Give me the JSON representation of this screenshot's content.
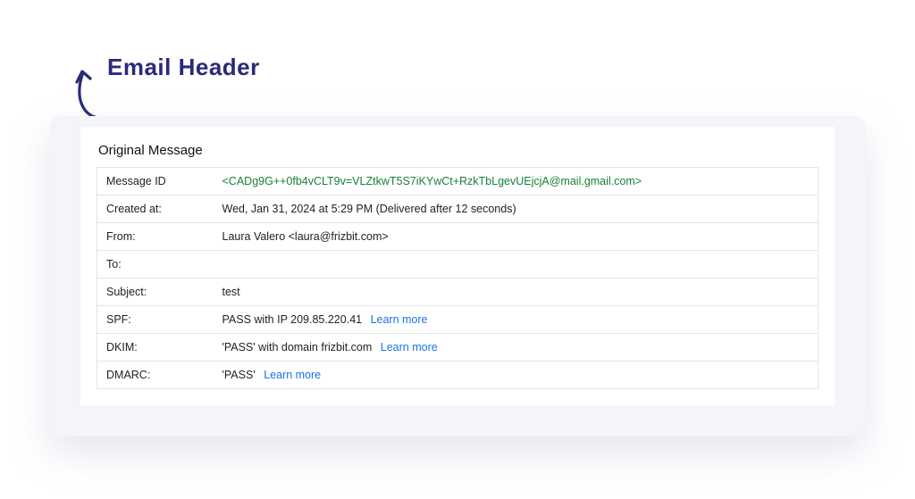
{
  "annotation": {
    "title": "Email Header"
  },
  "panel": {
    "title": "Original Message"
  },
  "rows": {
    "message_id": {
      "label": "Message ID",
      "value": "<CADg9G++0fb4vCLT9v=VLZtkwT5S7iKYwCt+RzkTbLgevUEjcjA@mail.gmail.com>"
    },
    "created_at": {
      "label": "Created at:",
      "value": "Wed, Jan 31, 2024 at 5:29 PM (Delivered after 12 seconds)"
    },
    "from": {
      "label": "From:",
      "value": "Laura Valero <laura@frizbit.com>"
    },
    "to": {
      "label": "To:",
      "value": ""
    },
    "subject": {
      "label": "Subject:",
      "value": "test"
    },
    "spf": {
      "label": "SPF:",
      "value": "PASS with IP 209.85.220.41",
      "link": "Learn more"
    },
    "dkim": {
      "label": "DKIM:",
      "value": "'PASS' with domain frizbit.com",
      "link": "Learn more"
    },
    "dmarc": {
      "label": "DMARC:",
      "value": "'PASS'",
      "link": "Learn more"
    }
  }
}
